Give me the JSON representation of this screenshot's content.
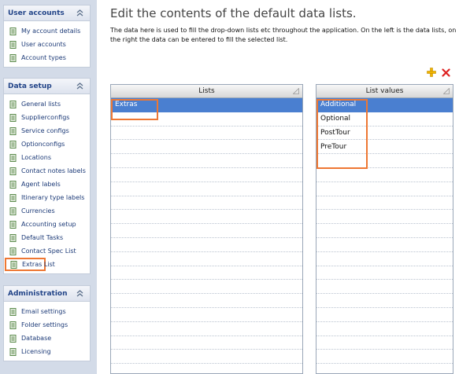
{
  "sidebar": {
    "panels": [
      {
        "title": "User accounts",
        "items": [
          {
            "label": "My account details"
          },
          {
            "label": "User accounts"
          },
          {
            "label": "Account types"
          }
        ]
      },
      {
        "title": "Data setup",
        "items": [
          {
            "label": "General lists"
          },
          {
            "label": "Supplierconfigs"
          },
          {
            "label": "Service configs"
          },
          {
            "label": "Optionconfigs"
          },
          {
            "label": "Locations"
          },
          {
            "label": "Contact notes labels"
          },
          {
            "label": "Agent labels"
          },
          {
            "label": "Itinerary type labels"
          },
          {
            "label": "Currencies"
          },
          {
            "label": "Accounting setup"
          },
          {
            "label": "Default Tasks"
          },
          {
            "label": "Contact Spec List"
          },
          {
            "label": "Extras List"
          }
        ]
      },
      {
        "title": "Administration",
        "items": [
          {
            "label": "Email settings"
          },
          {
            "label": "Folder settings"
          },
          {
            "label": "Database"
          },
          {
            "label": "Licensing"
          }
        ]
      }
    ],
    "active_item": "Extras List"
  },
  "main": {
    "title": "Edit the contents of the default data lists.",
    "description": "The data here is used to fill the drop-down lists etc throughout the application. On the left is the data lists, on the right the data can be entered to fill the selected list.",
    "toolbar": {
      "add_icon": "plus-icon",
      "delete_icon": "x-icon"
    },
    "lists_grid": {
      "header": "Lists",
      "rows": [
        "Extras"
      ],
      "selected_index": 0
    },
    "values_grid": {
      "header": "List values",
      "rows": [
        "Additional",
        "Optional",
        "PostTour",
        "PreTour"
      ],
      "selected_index": 0
    }
  },
  "colors": {
    "sidebar_bg": "#d3dbe8",
    "panel_title": "#224488",
    "selection": "#4a7fd0",
    "highlight": "#ee7733",
    "add_icon": "#e8a800",
    "delete_icon": "#dd2222"
  }
}
